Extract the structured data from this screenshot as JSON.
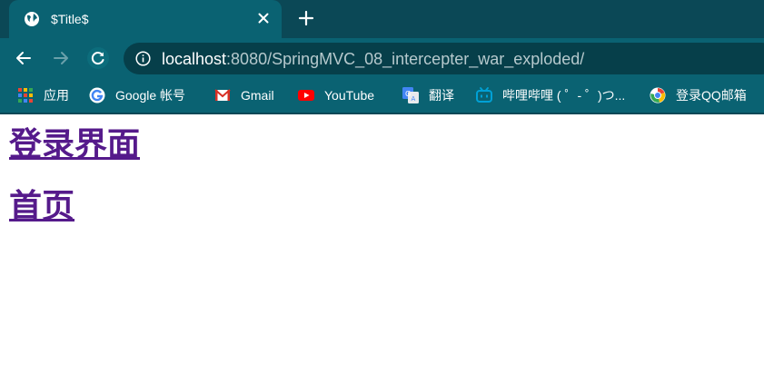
{
  "browser": {
    "tab": {
      "title": "$Title$",
      "favicon": "globe-icon",
      "close_icon": "close-icon"
    },
    "new_tab_icon": "plus-icon",
    "toolbar": {
      "back_icon": "back-arrow-icon",
      "forward_icon": "forward-arrow-icon",
      "reload_icon": "reload-icon",
      "info_icon": "info-icon",
      "url_host": "localhost",
      "url_path": ":8080/SpringMVC_08_intercepter_war_exploded/"
    },
    "bookmarks": [
      {
        "label": "应用",
        "icon": "apps-grid-icon"
      },
      {
        "label": "Google 帐号",
        "icon": "google-icon"
      },
      {
        "label": "Gmail",
        "icon": "gmail-icon"
      },
      {
        "label": "YouTube",
        "icon": "youtube-icon"
      },
      {
        "label": "翻译",
        "icon": "translate-icon"
      },
      {
        "label": "哔哩哔哩 ( ゜- ゜)つ...",
        "icon": "bilibili-icon"
      },
      {
        "label": "登录QQ邮箱",
        "icon": "qq-mail-icon"
      }
    ],
    "colors": {
      "frame": "#0b4856",
      "toolbar": "#0a6272",
      "omnibox": "#063f4a",
      "visited_link": "#551a8b"
    }
  },
  "page": {
    "links": [
      {
        "label": "登录界面"
      },
      {
        "label": "首页"
      }
    ]
  }
}
